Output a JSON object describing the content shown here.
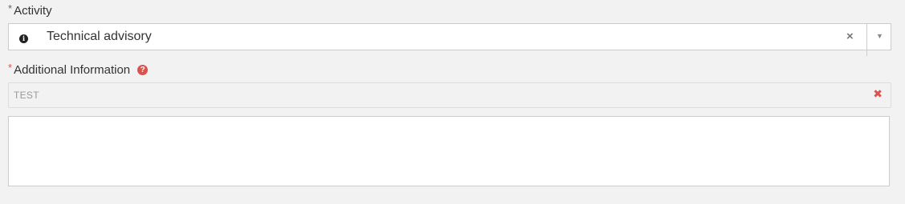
{
  "activity": {
    "required_mark": "*",
    "label": "Activity",
    "selected_value": "Technical advisory",
    "info_glyph": "i",
    "clear_glyph": "×",
    "arrow_glyph": "▼"
  },
  "additional_information": {
    "required_mark": "*",
    "label": "Additional Information",
    "help_glyph": "?",
    "tag_value": "TEST",
    "remove_glyph": "✖",
    "textarea_value": ""
  },
  "colors": {
    "background": "#f2f2f2",
    "required_red": "#d9534f",
    "border": "#cccccc"
  }
}
